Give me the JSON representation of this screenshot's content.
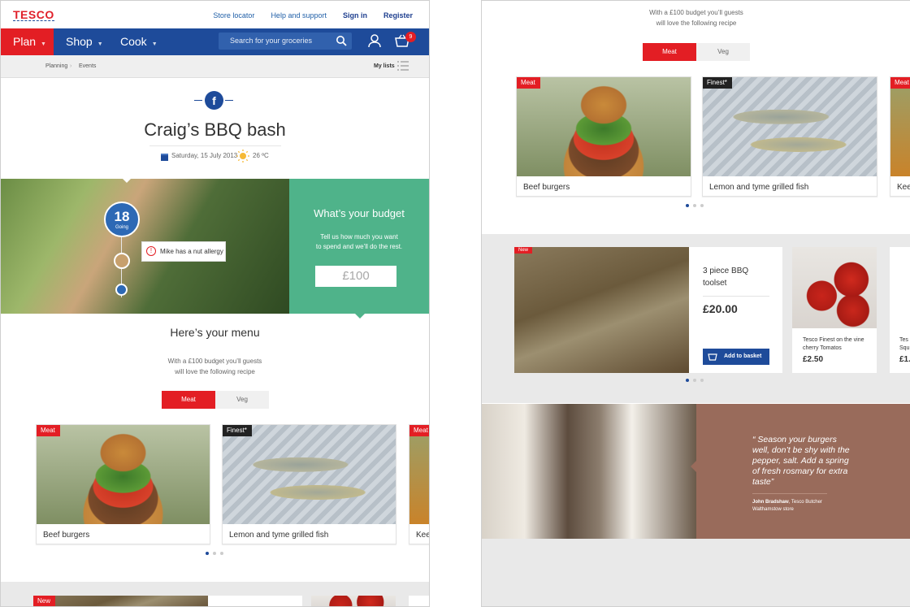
{
  "header": {
    "logo": "TESCO",
    "links": [
      "Store locator",
      "Help and support",
      "Sign in",
      "Register"
    ],
    "nav": [
      "Plan",
      "Shop",
      "Cook"
    ],
    "search_placeholder": "Search for your groceries",
    "basket_count": "9",
    "breadcrumb": [
      "Planning",
      "Events"
    ],
    "my_lists": "My lists"
  },
  "event": {
    "title": "Craig’s BBQ bash",
    "date": "Saturday, 15 July 2013",
    "temperature": "26 ºC",
    "going_count": "18",
    "going_label": "Going",
    "allergy_note": "Mike has a nut allergy"
  },
  "budget": {
    "heading": "What’s your budget",
    "text_line1": "Tell us how much you want",
    "text_line2": "to spend and we’ll do the rest.",
    "amount": "£100"
  },
  "menu": {
    "heading": "Here’s your menu",
    "sub_line1": "With a £100 budget you’ll guests",
    "sub_line2": "will love the following recipe",
    "tabs": [
      "Meat",
      "Veg"
    ],
    "recipes": [
      {
        "tag": "Meat",
        "name": "Beef burgers"
      },
      {
        "tag": "Finest*",
        "name": "Lemon and tyme grilled fish"
      },
      {
        "tag": "Meat",
        "name": "Kee"
      }
    ]
  },
  "products": {
    "new_tag": "New",
    "toolset_line1": "3 piece BBQ",
    "toolset_line2": "toolset",
    "toolset_price": "£20.00",
    "add_label": "Add to basket",
    "tomato_line1": "Tesco Finest on the vine",
    "tomato_line2": "cherry Tomatos",
    "tomato_price": "£2.50",
    "peek_line1": "Tes",
    "peek_line2": "Squ",
    "peek_price": "£1."
  },
  "quote": {
    "text_line1": "“ Season your burgers",
    "text_line2": "well, don’t be shy with the",
    "text_line3": "pepper, salt. Add a spring",
    "text_line4": "of fresh rosmary for extra",
    "text_line5": "taste”",
    "author": "John Bradshaw",
    "role": ", Tesco Butcher",
    "store": "Walthamstow store"
  },
  "colors": {
    "brand_blue": "#1e4b9a",
    "tesco_red": "#e31e24",
    "budget_green": "#4fb38a",
    "quote_brown": "#996b5b"
  }
}
